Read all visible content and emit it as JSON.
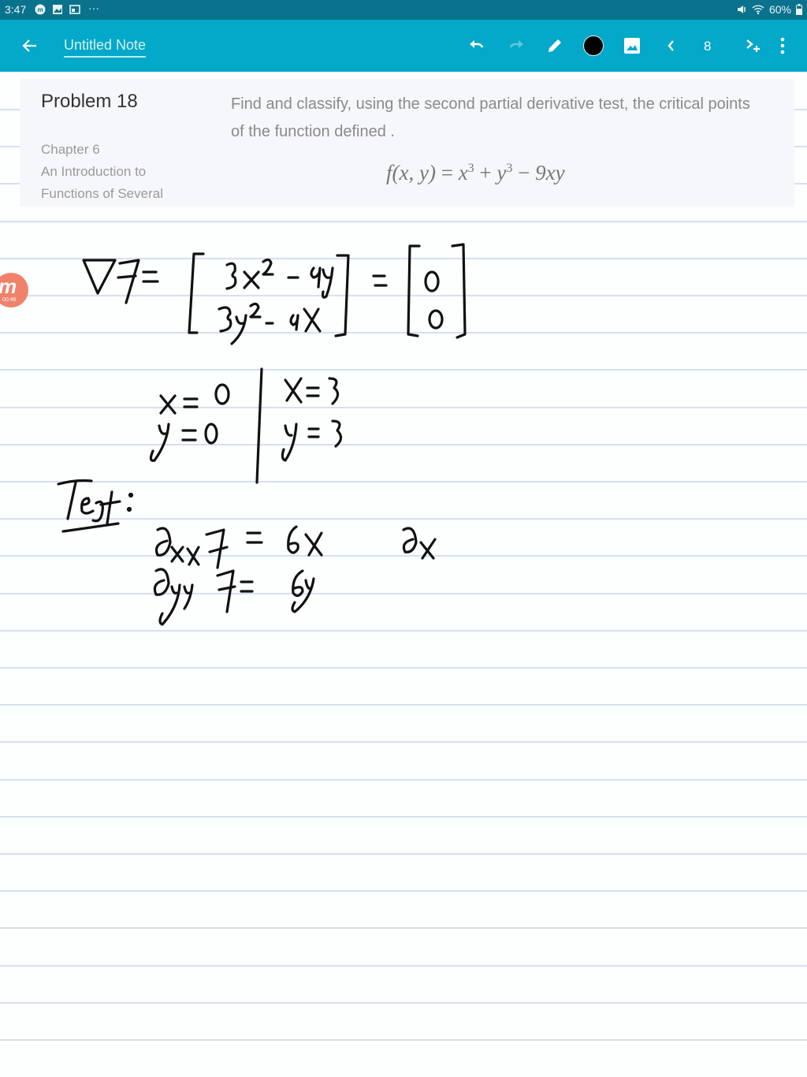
{
  "status_bar": {
    "time": "3:47",
    "left_icons": [
      "app-m-icon",
      "gallery-icon",
      "cast-icon",
      "more-dots-icon"
    ],
    "more": "···",
    "battery": "60%",
    "right_icons": [
      "mute-icon",
      "wifi-icon",
      "battery-icon"
    ]
  },
  "app_bar": {
    "title": "Untitled Note",
    "page_number": "8",
    "pen_color": "#000000",
    "tools": [
      "back-icon",
      "undo-icon",
      "redo-icon",
      "pen-icon",
      "color-picker",
      "image-icon",
      "prev-page-icon",
      "page-number",
      "add-page-icon",
      "overflow-menu-icon"
    ]
  },
  "problem_card": {
    "title": "Problem 18",
    "chapter": "Chapter 6",
    "book_line1": "An Introduction to",
    "book_line2": "Functions of Several",
    "description": "Find and classify, using the second partial derivative test, the critical points of the function defined .",
    "formula": {
      "lhs": "f(x, y)",
      "eq": "=",
      "t1": "x",
      "e1": "3",
      "plus": "+",
      "t2": "y",
      "e2": "3",
      "minus": "−",
      "t3": "9xy"
    }
  },
  "recording_badge": {
    "letter": "m",
    "timer": "00:46"
  },
  "handwriting": {
    "gradient_label": "∇f =",
    "gradient_row1": "3x² − 9y",
    "gradient_row2": "3y² − 9x",
    "equals": "=",
    "zero_row1": "0",
    "zero_row2": "0",
    "sol1_x": "x = 0",
    "sol1_y": "y = 0",
    "sol2_x": "x = 3",
    "sol2_y": "y = 3",
    "test_label": "Test:",
    "fxx": "∂xx f = 6x",
    "fyy": "∂yy f = 6y",
    "partial_x": "∂x"
  },
  "colors": {
    "status_bar": "#0a728c",
    "app_bar": "#04a8c8",
    "rule_line": "#d5e0f2",
    "ink": "#111111",
    "badge": "#f0816b"
  }
}
